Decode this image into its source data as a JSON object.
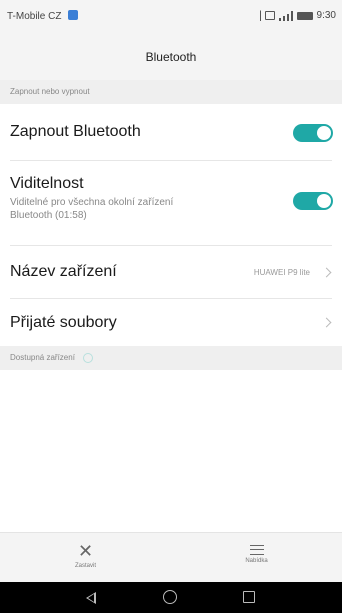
{
  "status_bar": {
    "carrier": "T-Mobile CZ",
    "time": "9:30",
    "icons": [
      "picture-icon",
      "bluetooth-icon",
      "nfc-icon",
      "signal-icon",
      "battery-icon"
    ]
  },
  "app_bar": {
    "title": "Bluetooth"
  },
  "section_toggle": {
    "label": "Zapnout nebo vypnout"
  },
  "bluetooth_toggle": {
    "label": "Zapnout Bluetooth",
    "state": "on"
  },
  "visibility": {
    "label": "Viditelnost",
    "description_line1": "Viditelné pro všechna okolní zařízení",
    "description_line2": "Bluetooth (01:58)",
    "state": "on"
  },
  "device_name": {
    "label": "Název zařízení",
    "value": "HUAWEI P9 lite"
  },
  "received_files": {
    "label": "Přijaté soubory"
  },
  "available_devices": {
    "label": "Dostupná zařízení"
  },
  "bottom_bar": {
    "stop_label": "Zastavit",
    "menu_label": "Nabídka"
  },
  "colors": {
    "accent": "#1fa8a6",
    "background": "#ffffff",
    "bar_background": "#f4f4f4"
  }
}
